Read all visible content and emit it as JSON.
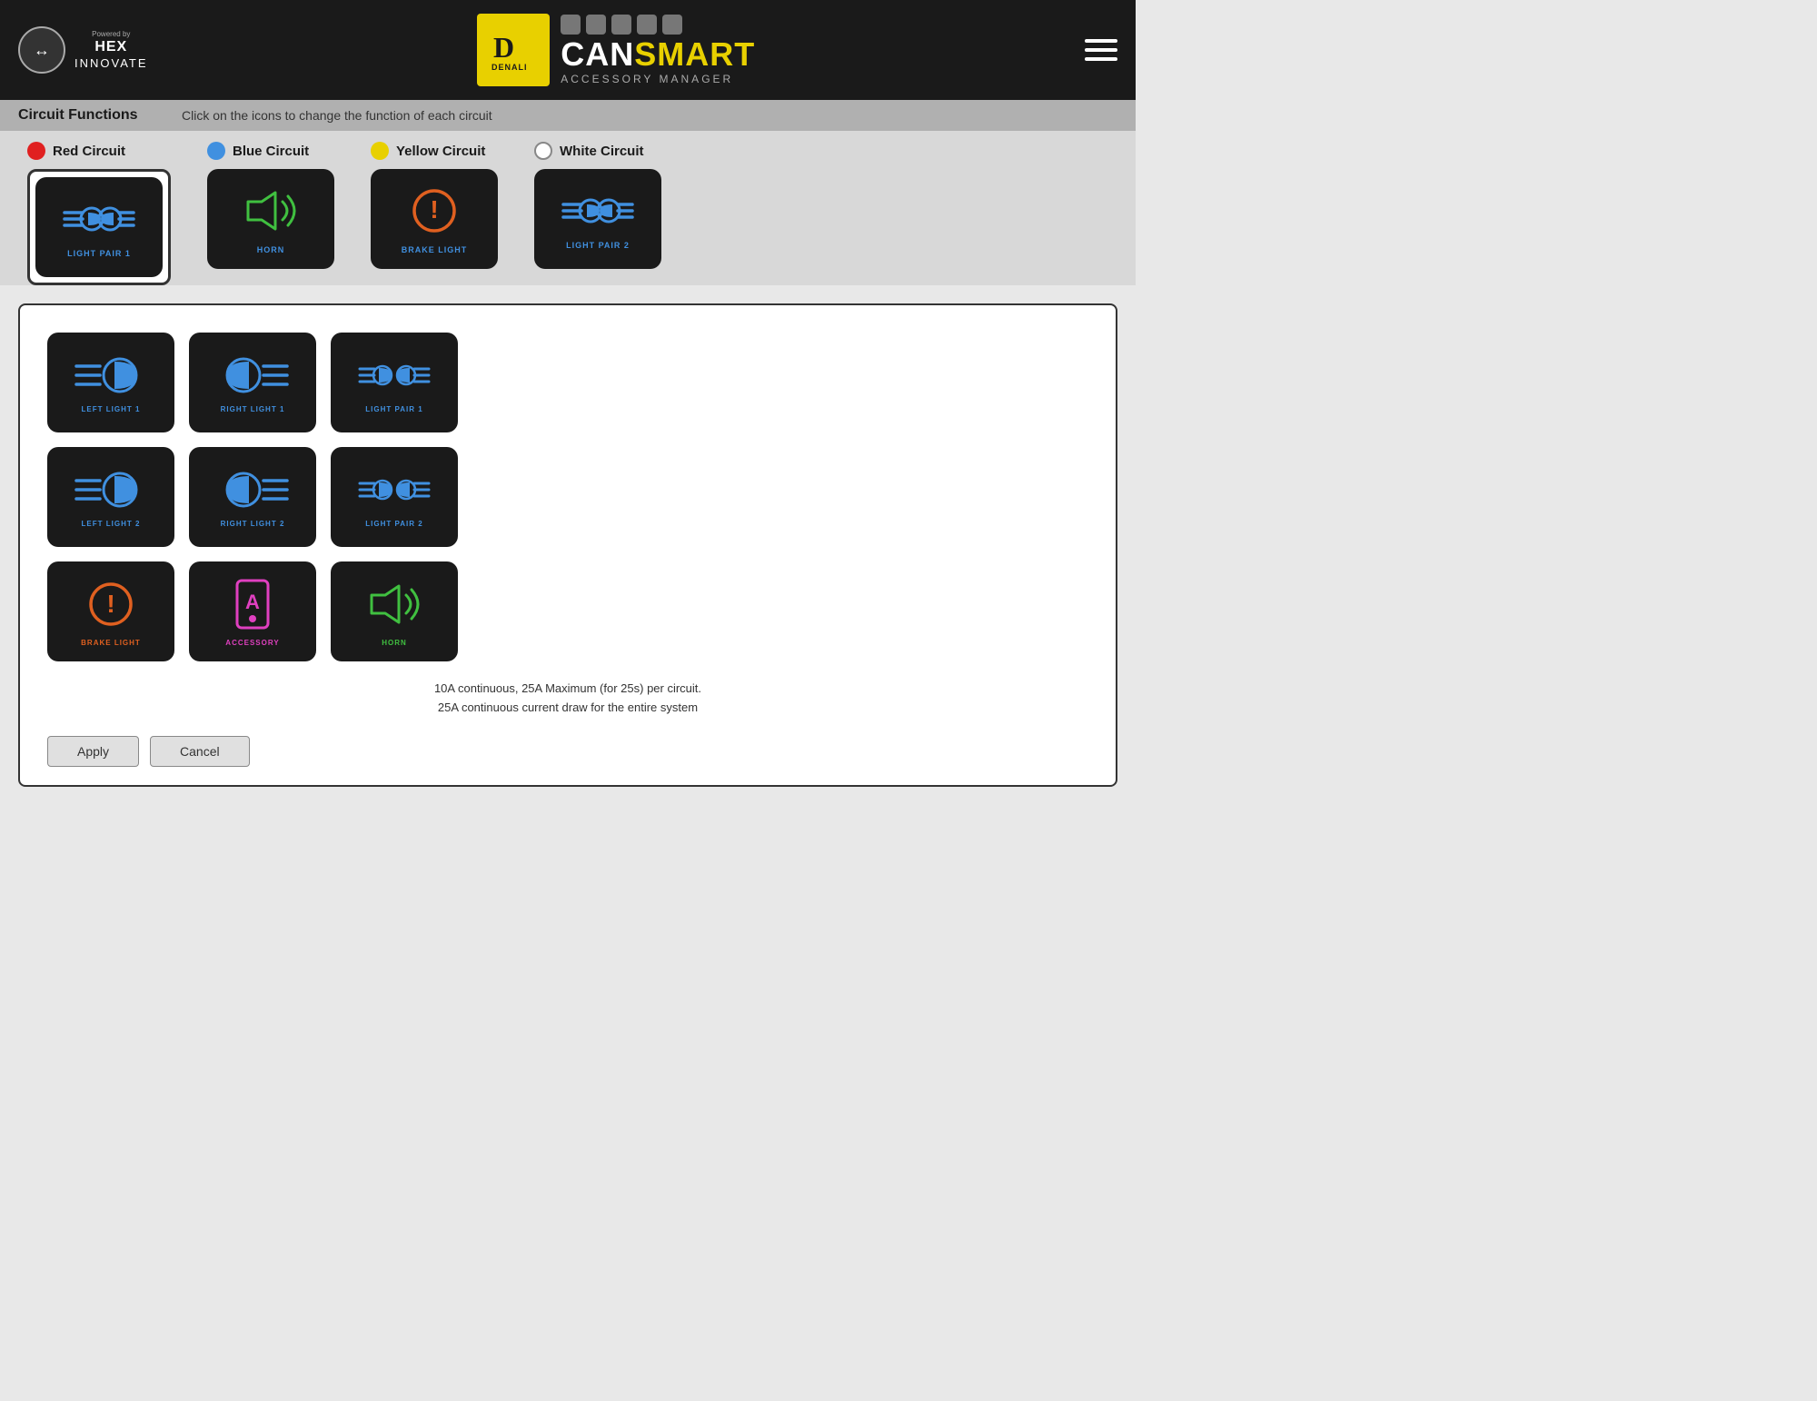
{
  "header": {
    "powered_by": "Powered by",
    "brand_name": "HEX",
    "brand_sub": "INNOVATE",
    "logo_icon": "↔",
    "app_title_can": "CAN",
    "app_title_smart": "SMART",
    "app_subtitle": "ACCESSORY MANAGER",
    "denali_label": "D",
    "menu_icon": "hamburger-icon"
  },
  "circuit_bar": {
    "title": "Circuit Functions",
    "description": "Click on the icons to change the function of each circuit"
  },
  "circuits": [
    {
      "id": "red",
      "label": "Red Circuit",
      "color": "red",
      "icon_label": "LIGHT PAIR 1",
      "active": true
    },
    {
      "id": "blue",
      "label": "Blue Circuit",
      "color": "blue",
      "icon_label": "HORN",
      "active": false
    },
    {
      "id": "yellow",
      "label": "Yellow Circuit",
      "color": "yellow",
      "icon_label": "BRAKE LIGHT",
      "active": false
    },
    {
      "id": "white",
      "label": "White Circuit",
      "color": "white",
      "icon_label": "LIGHT PAIR 2",
      "active": false
    }
  ],
  "selection_grid": [
    {
      "id": "left-light-1",
      "label": "LEFT LIGHT 1",
      "color_class": "blue",
      "type": "left-light"
    },
    {
      "id": "right-light-1",
      "label": "RIGHT LIGHT 1",
      "color_class": "blue",
      "type": "right-light"
    },
    {
      "id": "light-pair-1",
      "label": "LIGHT PAIR 1",
      "color_class": "blue",
      "type": "light-pair"
    },
    {
      "id": "left-light-2",
      "label": "LEFT LIGHT 2",
      "color_class": "blue",
      "type": "left-light"
    },
    {
      "id": "right-light-2",
      "label": "RIGHT LIGHT 2",
      "color_class": "blue",
      "type": "right-light"
    },
    {
      "id": "light-pair-2",
      "label": "LIGHT PAIR 2",
      "color_class": "blue",
      "type": "light-pair"
    },
    {
      "id": "brake-light",
      "label": "BRAKE LIGHT",
      "color_class": "orange",
      "type": "brake"
    },
    {
      "id": "accessory",
      "label": "ACCESSORY",
      "color_class": "pink",
      "type": "accessory"
    },
    {
      "id": "horn",
      "label": "HORN",
      "color_class": "green",
      "type": "horn"
    }
  ],
  "info_text_line1": "10A continuous, 25A Maximum (for 25s) per circuit.",
  "info_text_line2": "25A continuous current  draw for the entire system",
  "buttons": {
    "apply": "Apply",
    "cancel": "Cancel"
  }
}
